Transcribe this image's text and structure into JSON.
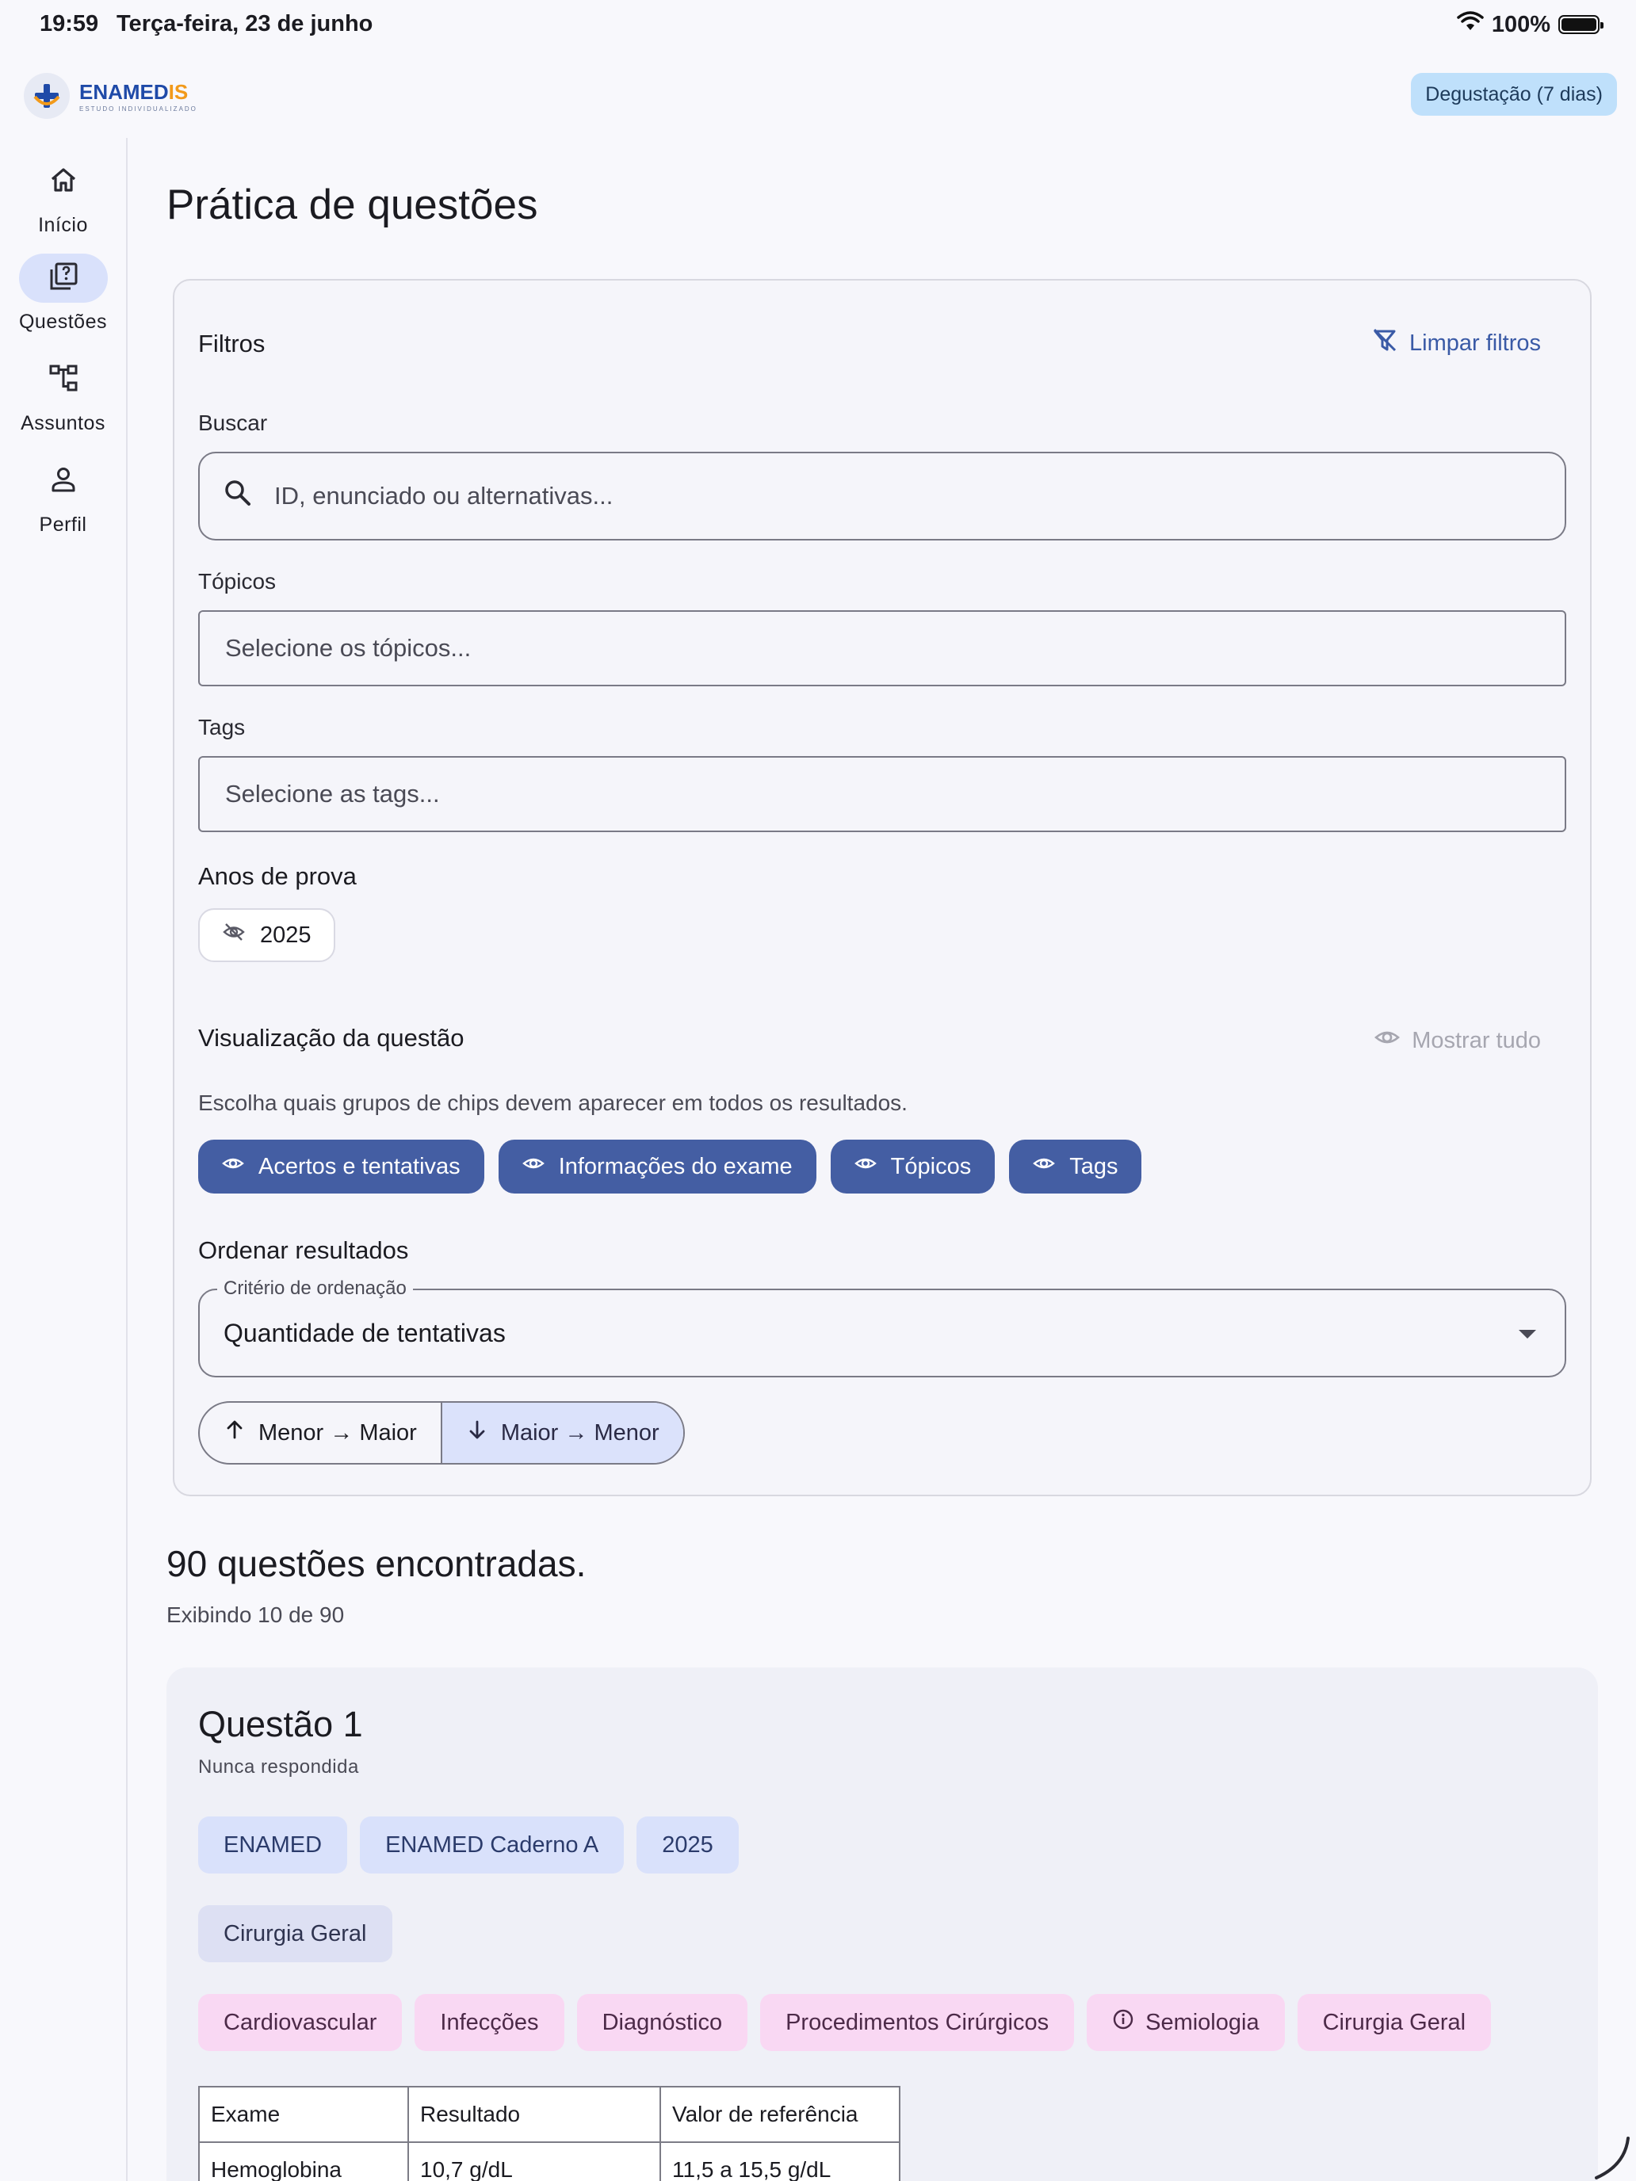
{
  "status_bar": {
    "time": "19:59",
    "date": "Terça-feira, 23 de junho",
    "battery": "100%"
  },
  "app": {
    "logo_main": "ENAMED",
    "logo_accent": "IS",
    "logo_sub": "ESTUDO INDIVIDUALIZADO",
    "trial_badge": "Degustação (7 dias)"
  },
  "nav": [
    {
      "label": "Início",
      "icon": "home-icon",
      "active": false
    },
    {
      "label": "Questões",
      "icon": "quiz-icon",
      "active": true
    },
    {
      "label": "Assuntos",
      "icon": "tree-icon",
      "active": false
    },
    {
      "label": "Perfil",
      "icon": "person-icon",
      "active": false
    }
  ],
  "page": {
    "title": "Prática de questões"
  },
  "filters": {
    "title": "Filtros",
    "clear_label": "Limpar filtros",
    "search_label": "Buscar",
    "search_placeholder": "ID, enunciado ou alternativas...",
    "topics_label": "Tópicos",
    "topics_placeholder": "Selecione os tópicos...",
    "tags_label": "Tags",
    "tags_placeholder": "Selecione as tags...",
    "years_label": "Anos de prova",
    "year_chip": "2025"
  },
  "visualization": {
    "title": "Visualização da questão",
    "show_all": "Mostrar tudo",
    "helper": "Escolha quais grupos de chips devem aparecer em todos os resultados.",
    "chips": [
      "Acertos e tentativas",
      "Informações do exame",
      "Tópicos",
      "Tags"
    ]
  },
  "ordering": {
    "title": "Ordenar resultados",
    "criterion_label": "Critério de ordenação",
    "criterion_value": "Quantidade de tentativas",
    "asc_label": "Menor → Maior",
    "desc_label": "Maior → Menor",
    "selected": "desc"
  },
  "results": {
    "title": "90 questões encontradas.",
    "subtitle": "Exibindo 10 de 90"
  },
  "question": {
    "title": "Questão 1",
    "status": "Nunca respondida",
    "exam_chips": [
      "ENAMED",
      "ENAMED Caderno A",
      "2025"
    ],
    "topic_chips": [
      "Cirurgia Geral"
    ],
    "tag_chips": [
      "Cardiovascular",
      "Infecções",
      "Diagnóstico",
      "Procedimentos Cirúrgicos",
      "Semiologia",
      "Cirurgia Geral"
    ],
    "table": {
      "headers": [
        "Exame",
        "Resultado",
        "Valor de referência"
      ],
      "rows": [
        [
          "Hemoglobina",
          "10,7 g/dL",
          "11,5 a 15,5 g/dL"
        ]
      ]
    }
  },
  "colors": {
    "primary": "#445ea3",
    "chip_blue": "#d9e1fb",
    "chip_pink": "#f9d8f3",
    "trial_badge": "#bfe0fb"
  }
}
